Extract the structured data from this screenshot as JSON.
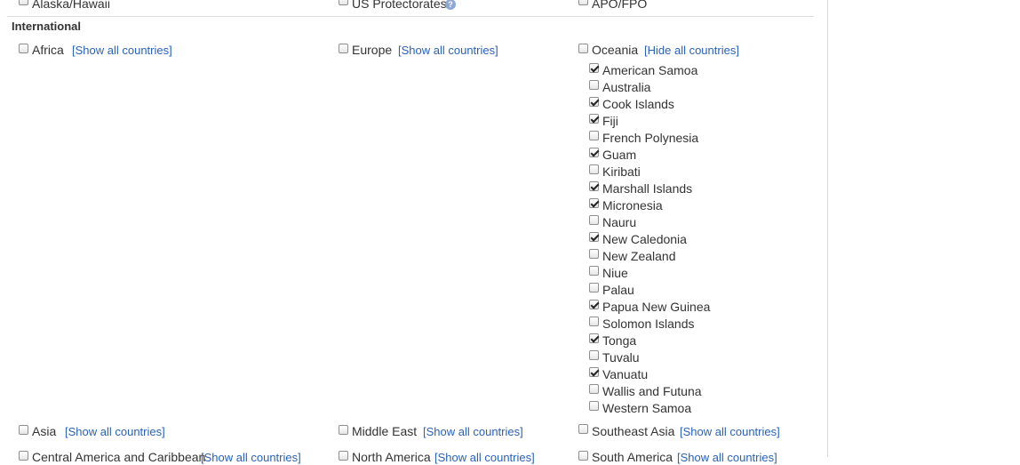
{
  "domestic": {
    "items": [
      {
        "label": "Alaska/Hawaii",
        "checked": false
      },
      {
        "label": "US Protectorates",
        "checked": false
      },
      {
        "label": "APO/FPO",
        "checked": false
      }
    ],
    "help_glyph": "?"
  },
  "international": {
    "heading": "International",
    "show_link": "[Show all countries]",
    "hide_link": "[Hide all countries]",
    "regions_row1": [
      {
        "label": "Africa",
        "checked": false
      },
      {
        "label": "Europe",
        "checked": false
      },
      {
        "label": "Oceania",
        "checked": false
      }
    ],
    "oceania_countries": [
      {
        "label": "American Samoa",
        "checked": true
      },
      {
        "label": "Australia",
        "checked": false
      },
      {
        "label": "Cook Islands",
        "checked": true
      },
      {
        "label": "Fiji",
        "checked": true
      },
      {
        "label": "French Polynesia",
        "checked": false
      },
      {
        "label": "Guam",
        "checked": true
      },
      {
        "label": "Kiribati",
        "checked": false
      },
      {
        "label": "Marshall Islands",
        "checked": true
      },
      {
        "label": "Micronesia",
        "checked": true
      },
      {
        "label": "Nauru",
        "checked": false
      },
      {
        "label": "New Caledonia",
        "checked": true
      },
      {
        "label": "New Zealand",
        "checked": false
      },
      {
        "label": "Niue",
        "checked": false
      },
      {
        "label": "Palau",
        "checked": false
      },
      {
        "label": "Papua New Guinea",
        "checked": true
      },
      {
        "label": "Solomon Islands",
        "checked": false
      },
      {
        "label": "Tonga",
        "checked": true
      },
      {
        "label": "Tuvalu",
        "checked": false
      },
      {
        "label": "Vanuatu",
        "checked": true
      },
      {
        "label": "Wallis and Futuna",
        "checked": false
      },
      {
        "label": "Western Samoa",
        "checked": false
      }
    ],
    "regions_row2": [
      {
        "label": "Asia",
        "checked": false
      },
      {
        "label": "Middle East",
        "checked": false
      },
      {
        "label": "Southeast Asia",
        "checked": false
      }
    ],
    "regions_row3": [
      {
        "label": "Central America and Caribbean",
        "checked": false
      },
      {
        "label": "North America",
        "checked": false
      },
      {
        "label": "South America",
        "checked": false
      }
    ]
  }
}
